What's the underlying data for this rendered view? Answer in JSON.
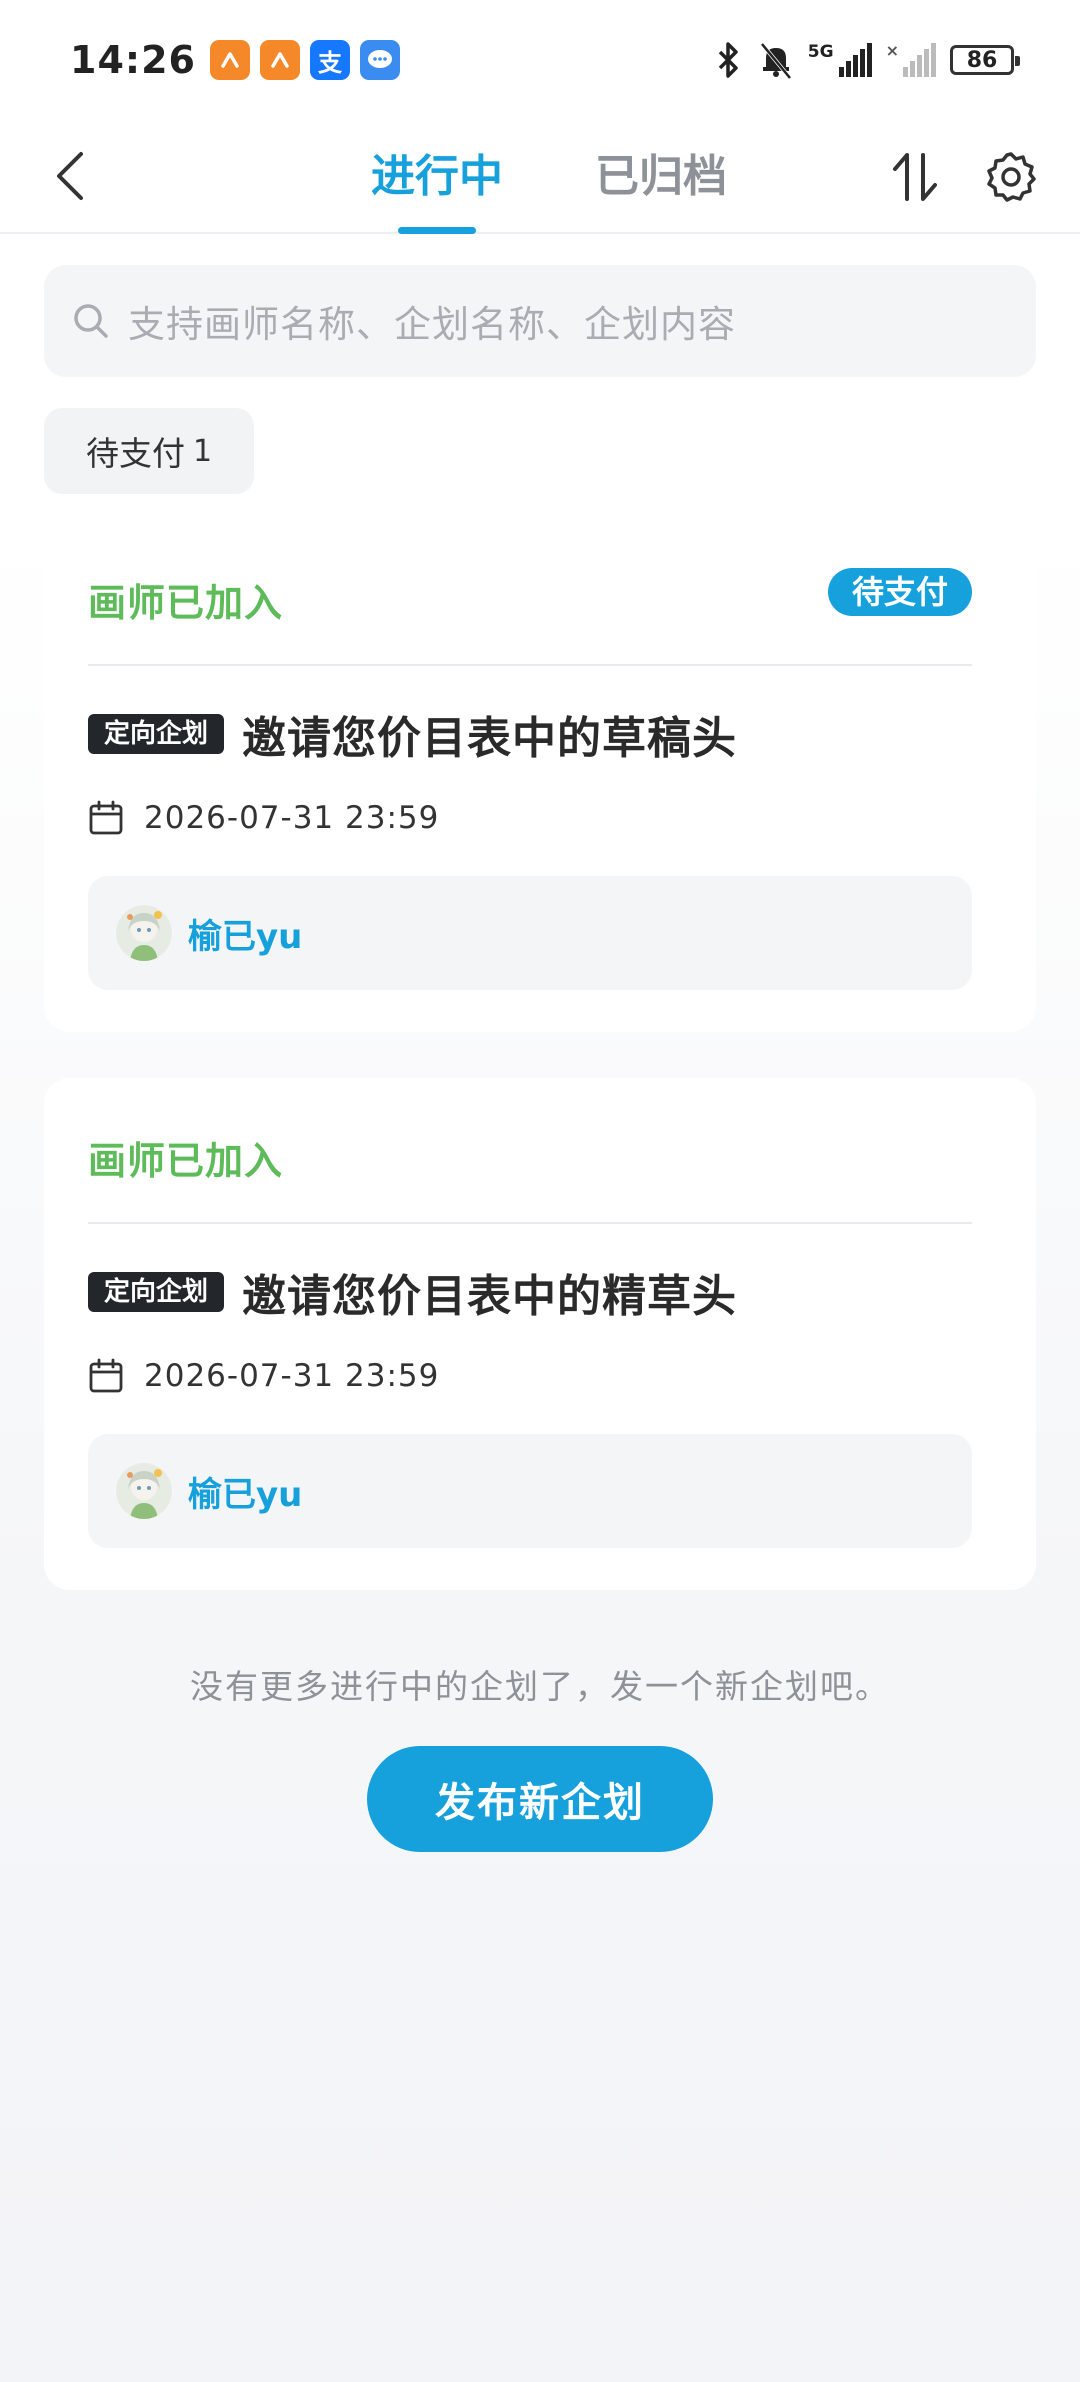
{
  "status_bar": {
    "time": "14:26",
    "notification_icons": [
      {
        "icon": "orange-app-icon",
        "glyph": ""
      },
      {
        "icon": "orange-app-icon",
        "glyph": ""
      },
      {
        "icon": "alipay-icon",
        "glyph": "支"
      },
      {
        "icon": "message-icon",
        "glyph": "…"
      }
    ],
    "network_label": "5G",
    "battery": "86"
  },
  "nav": {
    "tabs": [
      {
        "label": "进行中",
        "active": true
      },
      {
        "label": "已归档",
        "active": false
      }
    ]
  },
  "search": {
    "placeholder": "支持画师名称、企划名称、企划内容"
  },
  "filters": [
    {
      "label": "待支付",
      "count": "1"
    }
  ],
  "cards": [
    {
      "status": "画师已加入",
      "badge": "待支付",
      "tag": "定向企划",
      "title": "邀请您价目表中的草稿头",
      "deadline": "2026-07-31 23:59",
      "artist": "榆已yu"
    },
    {
      "status": "画师已加入",
      "badge": "",
      "tag": "定向企划",
      "title": "邀请您价目表中的精草头",
      "deadline": "2026-07-31 23:59",
      "artist": "榆已yu"
    }
  ],
  "footer": {
    "hint": "没有更多进行中的企划了，发一个新企划吧。",
    "publish_button": "发布新企划"
  },
  "colors": {
    "accent": "#16a0dc",
    "status_green": "#5dbb5a",
    "tag_dark": "#23262b"
  }
}
